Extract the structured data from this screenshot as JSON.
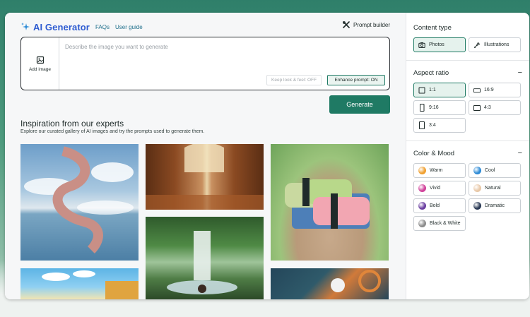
{
  "header": {
    "title": "AI Generator",
    "links": [
      "FAQs",
      "User guide"
    ],
    "prompt_builder": "Prompt builder"
  },
  "prompt": {
    "add_image_label": "Add image",
    "placeholder": "Describe the image you want to generate",
    "keep_look_label": "Keep look & feel: OFF",
    "enhance_label": "Enhance prompt: ON",
    "generate_label": "Generate"
  },
  "inspiration": {
    "title": "Inspiration from our experts",
    "subtitle": "Explore our curated gallery of AI images and try the prompts used to generate them."
  },
  "sidebar": {
    "content_type": {
      "title": "Content type",
      "options": [
        "Photos",
        "Illustrations"
      ],
      "selected": "Photos"
    },
    "aspect_ratio": {
      "title": "Aspect ratio",
      "collapse_symbol": "−",
      "options": [
        "1:1",
        "16:9",
        "9:16",
        "4:3",
        "3:4"
      ],
      "selected": "1:1"
    },
    "color_mood": {
      "title": "Color & Mood",
      "collapse_symbol": "−",
      "options": [
        {
          "label": "Warm",
          "color": "#f0a030"
        },
        {
          "label": "Cool",
          "color": "#2e8bd6"
        },
        {
          "label": "Vivid",
          "color": "#d0409a"
        },
        {
          "label": "Natural",
          "color": "#e8c8a8"
        },
        {
          "label": "Bold",
          "color": "#6a3ea0"
        },
        {
          "label": "Dramatic",
          "color": "#2a3a55"
        },
        {
          "label": "Black & White",
          "color": "#8c8c8c"
        }
      ]
    }
  },
  "colors": {
    "accent": "#1f7a64",
    "brand_title": "#2d5bd1"
  }
}
